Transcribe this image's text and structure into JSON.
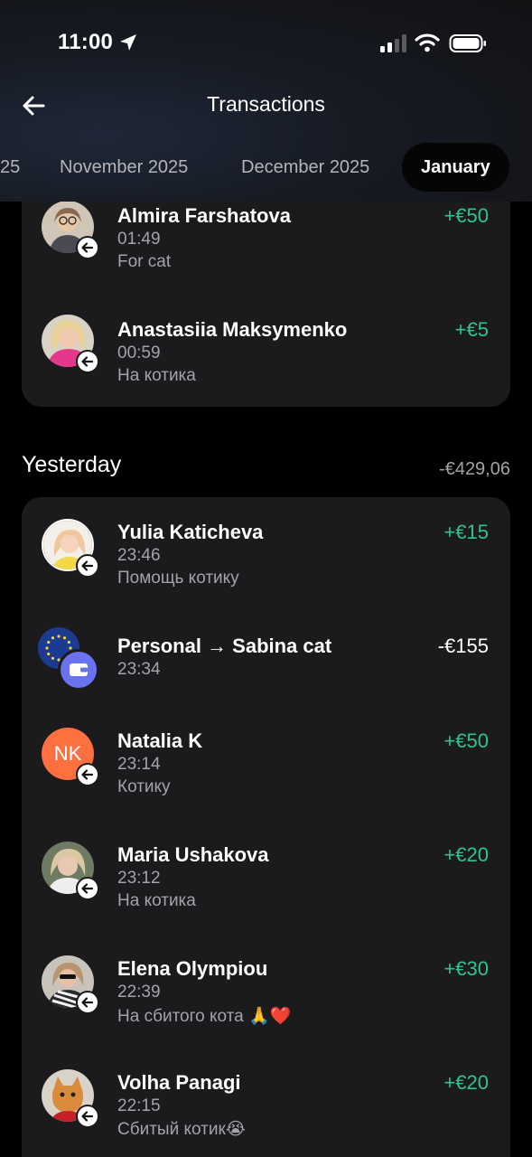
{
  "status_bar": {
    "time": "11:00"
  },
  "header": {
    "title": "Transactions"
  },
  "months": [
    {
      "label": "25"
    },
    {
      "label": "November 2025"
    },
    {
      "label": "December 2025"
    },
    {
      "label": "January",
      "active": true
    }
  ],
  "today_card": {
    "transactions": [
      {
        "name": "Almira Farshatova",
        "time": "01:49",
        "note": "For cat",
        "amount": "+€50"
      },
      {
        "name": "Anastasiia Maksymenko",
        "time": "00:59",
        "note": "На котика",
        "amount": "+€5"
      }
    ]
  },
  "yesterday": {
    "title": "Yesterday",
    "total": "-€429,06",
    "transactions": [
      {
        "name": "Yulia Katicheva",
        "time": "23:46",
        "note": "Помощь котику",
        "amount": "+€15"
      },
      {
        "name": "Personal → Sabina cat",
        "time": "23:34",
        "note": "",
        "amount": "-€155"
      },
      {
        "name": "Natalia K",
        "initials": "NK",
        "time": "23:14",
        "note": "Котику",
        "amount": "+€50"
      },
      {
        "name": "Maria Ushakova",
        "time": "23:12",
        "note": "На котика",
        "amount": "+€20"
      },
      {
        "name": "Elena Olympiou",
        "time": "22:39",
        "note": "На сбитого кота 🙏❤️",
        "amount": "+€30"
      },
      {
        "name": "Volha Panagi",
        "time": "22:15",
        "note": "Сбитый котик😭",
        "amount": "+€20"
      }
    ]
  },
  "colors": {
    "positive": "#2ec48f",
    "negative": "#ffffff",
    "card": "#1b1b1d",
    "accent_avatar": "#ff7040"
  },
  "icons": [
    "location-arrow-icon",
    "signal-icon",
    "wifi-icon",
    "battery-icon",
    "back-arrow-icon",
    "incoming-arrow-icon",
    "wallet-icon",
    "eu-flag-icon"
  ]
}
